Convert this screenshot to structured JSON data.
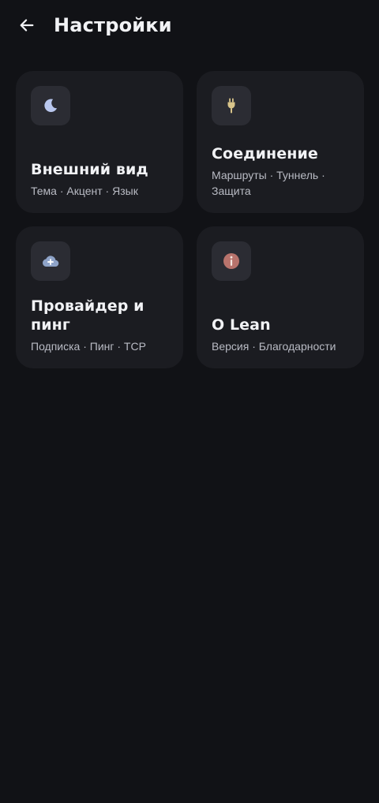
{
  "header": {
    "title": "Настройки"
  },
  "cards": [
    {
      "icon": "moon-icon",
      "title": "Внешний вид",
      "subtitle": "Тема · Акцент · Язык"
    },
    {
      "icon": "plug-icon",
      "title": "Соединение",
      "subtitle": "Маршруты · Туннель · Защита"
    },
    {
      "icon": "cloud-plus-icon",
      "title": "Провайдер и пинг",
      "subtitle": "Подписка · Пинг · TCP"
    },
    {
      "icon": "info-icon",
      "title": "О Lean",
      "subtitle": "Версия · Благодарности"
    }
  ],
  "colors": {
    "background": "#111216",
    "card": "#1b1c21",
    "icon_tile": "#2b2c33",
    "moon": "#b9c7ee",
    "plug": "#d8c48a",
    "cloud": "#8ea3c8",
    "info": "#b8736c"
  }
}
